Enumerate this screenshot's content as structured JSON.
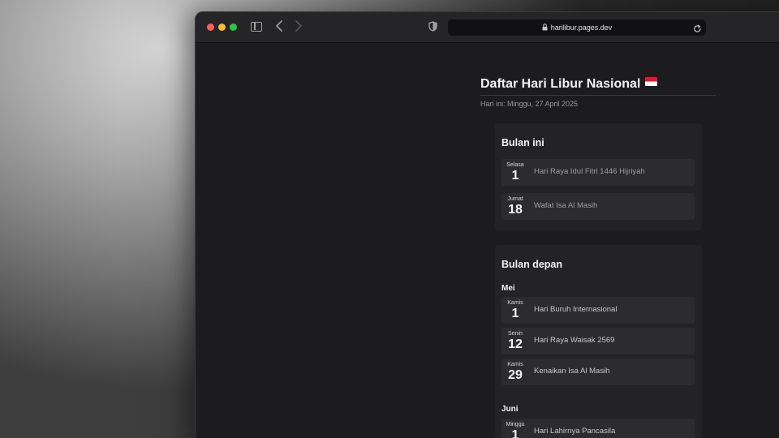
{
  "browser": {
    "url": "harilibur.pages.dev",
    "icons": [
      "sidebar-icon",
      "back-icon",
      "forward-icon",
      "shield-icon",
      "lock-icon",
      "reload-icon"
    ]
  },
  "page": {
    "title": "Daftar Hari Libur Nasional",
    "today": "Hari ini: Minggu, 27 April 2025"
  },
  "this_month": {
    "heading": "Bulan ini",
    "holidays": [
      {
        "day": "Selasa",
        "date": "1",
        "name": "Hari Raya Idul Fitri 1446 Hijriyah"
      },
      {
        "day": "Jumat",
        "date": "18",
        "name": "Wafat Isa Al Masih"
      }
    ]
  },
  "next_months": {
    "heading": "Bulan depan",
    "months": [
      {
        "name": "Mei",
        "holidays": [
          {
            "day": "Kamis",
            "date": "1",
            "name": "Hari Buruh Internasional"
          },
          {
            "day": "Senin",
            "date": "12",
            "name": "Hari Raya Waisak 2569"
          },
          {
            "day": "Kamis",
            "date": "29",
            "name": "Kenaikan Isa Al Masih"
          }
        ]
      },
      {
        "name": "Juni",
        "holidays": [
          {
            "day": "Minggu",
            "date": "1",
            "name": "Hari Lahirnya Pancasila"
          }
        ]
      }
    ]
  },
  "colors": {
    "traffic_red": "#ff5f57",
    "traffic_yellow": "#febc2e",
    "traffic_green": "#28c840",
    "page_bg": "#1c1c1e",
    "card_bg": "#232325",
    "item_bg": "#2c2c2e"
  }
}
